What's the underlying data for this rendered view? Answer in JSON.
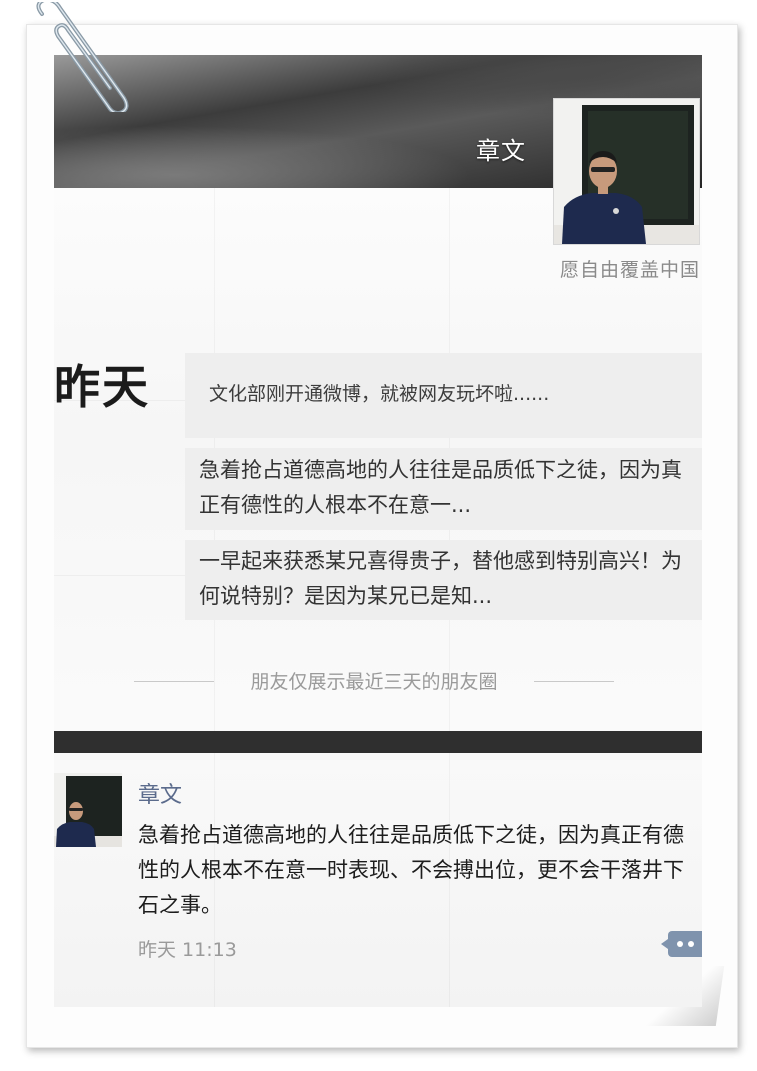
{
  "header": {
    "name": "章文",
    "signature": "愿自由覆盖中国"
  },
  "timeline": {
    "date_label": "昨天",
    "posts": [
      {
        "text": "文化部刚开通微博，就被网友玩坏啦......"
      },
      {
        "text": "急着抢占道德高地的人往往是品质低下之徒，因为真正有德性的人根本不在意一..."
      },
      {
        "text": "一早起来获悉某兄喜得贵子，替他感到特别高兴！为何说特别？是因为某兄已是知..."
      }
    ],
    "notice": "朋友仅展示最近三天的朋友圈"
  },
  "detail": {
    "author": "章文",
    "text": "急着抢占道德高地的人往往是品质低下之徒，因为真正有德性的人根本不在意一时表现、不会搏出位，更不会干落井下石之事。",
    "time": "昨天 11:13"
  },
  "icons": {
    "paperclip": "paperclip-icon",
    "comment": "comment-icon"
  },
  "colors": {
    "author_link": "#5b6b8c",
    "comment_button": "#7f93ad",
    "card_background": "#eeeeee"
  }
}
